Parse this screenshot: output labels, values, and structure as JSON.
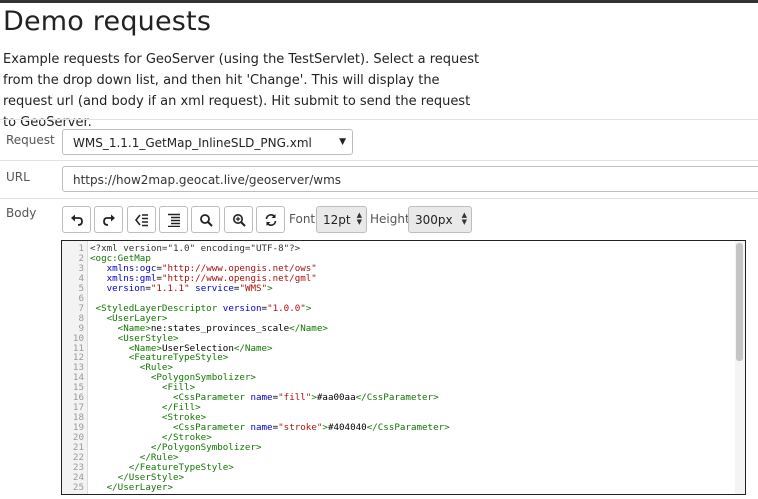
{
  "page": {
    "title": "Demo requests",
    "description": "Example requests for GeoServer (using the TestServlet). Select a request from the drop down list, and then hit 'Change'. This will display the request url (and body if an xml request). Hit submit to send the request to GeoServer."
  },
  "form": {
    "request_label": "Request",
    "request_value": "WMS_1.1.1_GetMap_InlineSLD_PNG.xml",
    "url_label": "URL",
    "url_value": "https://how2map.geocat.live/geoserver/wms",
    "body_label": "Body"
  },
  "toolbar": {
    "buttons": [
      "undo-icon",
      "redo-icon",
      "unindent-icon",
      "format-icon",
      "search-icon",
      "zoom-in-icon",
      "replace-icon"
    ],
    "font_label": "Font",
    "font_value": "12pt",
    "height_label": "Height",
    "height_value": "300px"
  },
  "editor": {
    "lines": [
      {
        "n": "1",
        "segs": [
          {
            "c": "decl",
            "t": "<?xml version=\"1.0\" encoding=\"UTF-8\"?>"
          }
        ]
      },
      {
        "n": "2",
        "segs": [
          {
            "c": "tag",
            "t": "<ogc:GetMap"
          }
        ]
      },
      {
        "n": "3",
        "segs": [
          {
            "c": "text",
            "t": "   "
          },
          {
            "c": "attr",
            "t": "xmlns:ogc"
          },
          {
            "c": "text",
            "t": "="
          },
          {
            "c": "str",
            "t": "\"http://www.opengis.net/ows\""
          }
        ]
      },
      {
        "n": "4",
        "segs": [
          {
            "c": "text",
            "t": "   "
          },
          {
            "c": "attr",
            "t": "xmlns:gml"
          },
          {
            "c": "text",
            "t": "="
          },
          {
            "c": "str",
            "t": "\"http://www.opengis.net/gml\""
          }
        ]
      },
      {
        "n": "5",
        "segs": [
          {
            "c": "text",
            "t": "   "
          },
          {
            "c": "attr",
            "t": "version"
          },
          {
            "c": "text",
            "t": "="
          },
          {
            "c": "str",
            "t": "\"1.1.1\""
          },
          {
            "c": "text",
            "t": " "
          },
          {
            "c": "attr",
            "t": "service"
          },
          {
            "c": "text",
            "t": "="
          },
          {
            "c": "str",
            "t": "\"WMS\""
          },
          {
            "c": "tag",
            "t": ">"
          }
        ]
      },
      {
        "n": "6",
        "segs": []
      },
      {
        "n": "7",
        "segs": [
          {
            "c": "text",
            "t": " "
          },
          {
            "c": "tag",
            "t": "<StyledLayerDescriptor"
          },
          {
            "c": "text",
            "t": " "
          },
          {
            "c": "attr",
            "t": "version"
          },
          {
            "c": "text",
            "t": "="
          },
          {
            "c": "str",
            "t": "\"1.0.0\""
          },
          {
            "c": "tag",
            "t": ">"
          }
        ]
      },
      {
        "n": "8",
        "segs": [
          {
            "c": "text",
            "t": "   "
          },
          {
            "c": "tag",
            "t": "<UserLayer>"
          }
        ]
      },
      {
        "n": "9",
        "segs": [
          {
            "c": "text",
            "t": "     "
          },
          {
            "c": "tag",
            "t": "<Name>"
          },
          {
            "c": "text",
            "t": "ne:states_provinces_scale"
          },
          {
            "c": "tag",
            "t": "</Name>"
          }
        ]
      },
      {
        "n": "10",
        "segs": [
          {
            "c": "text",
            "t": "     "
          },
          {
            "c": "tag",
            "t": "<UserStyle>"
          }
        ]
      },
      {
        "n": "11",
        "segs": [
          {
            "c": "text",
            "t": "       "
          },
          {
            "c": "tag",
            "t": "<Name>"
          },
          {
            "c": "text",
            "t": "UserSelection"
          },
          {
            "c": "tag",
            "t": "</Name>"
          }
        ]
      },
      {
        "n": "12",
        "segs": [
          {
            "c": "text",
            "t": "       "
          },
          {
            "c": "tag",
            "t": "<FeatureTypeStyle>"
          }
        ]
      },
      {
        "n": "13",
        "segs": [
          {
            "c": "text",
            "t": "         "
          },
          {
            "c": "tag",
            "t": "<Rule>"
          }
        ]
      },
      {
        "n": "14",
        "segs": [
          {
            "c": "text",
            "t": "           "
          },
          {
            "c": "tag",
            "t": "<PolygonSymbolizer>"
          }
        ]
      },
      {
        "n": "15",
        "segs": [
          {
            "c": "text",
            "t": "             "
          },
          {
            "c": "tag",
            "t": "<Fill>"
          }
        ]
      },
      {
        "n": "16",
        "segs": [
          {
            "c": "text",
            "t": "               "
          },
          {
            "c": "tag",
            "t": "<CssParameter"
          },
          {
            "c": "text",
            "t": " "
          },
          {
            "c": "attr",
            "t": "name"
          },
          {
            "c": "text",
            "t": "="
          },
          {
            "c": "str",
            "t": "\"fill\""
          },
          {
            "c": "tag",
            "t": ">"
          },
          {
            "c": "text",
            "t": "#aa00aa"
          },
          {
            "c": "tag",
            "t": "</CssParameter>"
          }
        ]
      },
      {
        "n": "17",
        "segs": [
          {
            "c": "text",
            "t": "             "
          },
          {
            "c": "tag",
            "t": "</Fill>"
          }
        ]
      },
      {
        "n": "18",
        "segs": [
          {
            "c": "text",
            "t": "             "
          },
          {
            "c": "tag",
            "t": "<Stroke>"
          }
        ]
      },
      {
        "n": "19",
        "segs": [
          {
            "c": "text",
            "t": "               "
          },
          {
            "c": "tag",
            "t": "<CssParameter"
          },
          {
            "c": "text",
            "t": " "
          },
          {
            "c": "attr",
            "t": "name"
          },
          {
            "c": "text",
            "t": "="
          },
          {
            "c": "str",
            "t": "\"stroke\""
          },
          {
            "c": "tag",
            "t": ">"
          },
          {
            "c": "text",
            "t": "#404040"
          },
          {
            "c": "tag",
            "t": "</CssParameter>"
          }
        ]
      },
      {
        "n": "20",
        "segs": [
          {
            "c": "text",
            "t": "             "
          },
          {
            "c": "tag",
            "t": "</Stroke>"
          }
        ]
      },
      {
        "n": "21",
        "segs": [
          {
            "c": "text",
            "t": "           "
          },
          {
            "c": "tag",
            "t": "</PolygonSymbolizer>"
          }
        ]
      },
      {
        "n": "22",
        "segs": [
          {
            "c": "text",
            "t": "         "
          },
          {
            "c": "tag",
            "t": "</Rule>"
          }
        ]
      },
      {
        "n": "23",
        "segs": [
          {
            "c": "text",
            "t": "       "
          },
          {
            "c": "tag",
            "t": "</FeatureTypeStyle>"
          }
        ]
      },
      {
        "n": "24",
        "segs": [
          {
            "c": "text",
            "t": "     "
          },
          {
            "c": "tag",
            "t": "</UserStyle>"
          }
        ]
      },
      {
        "n": "25",
        "segs": [
          {
            "c": "text",
            "t": "   "
          },
          {
            "c": "tag",
            "t": "</UserLayer>"
          }
        ]
      }
    ]
  }
}
